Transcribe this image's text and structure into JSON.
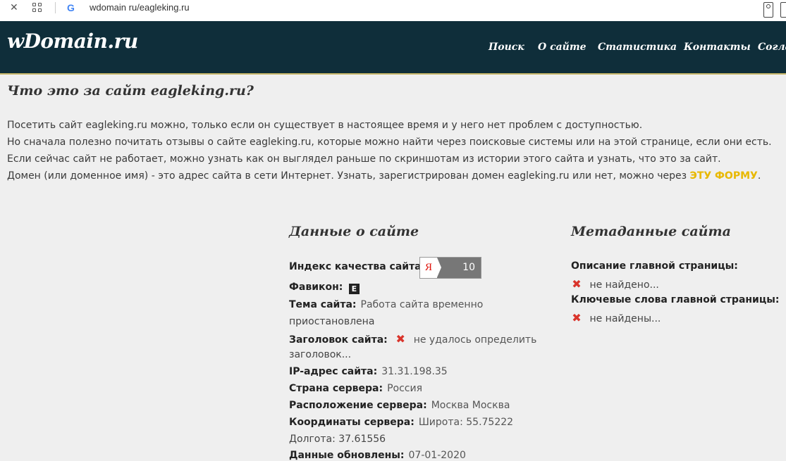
{
  "browser": {
    "close_glyph": "✕",
    "google_glyph": "G",
    "url": "wdomain ru/eagleking.ru"
  },
  "header": {
    "logo": "wDomain.ru",
    "nav": [
      "Поиск",
      "О сайте",
      "Статистика",
      "Контакты",
      "Согла"
    ]
  },
  "page": {
    "title": "Что это за сайт eagleking.ru?",
    "intro": [
      "Посетить сайт eagleking.ru можно, только если он существует в настоящее время и у него нет проблем с доступностью.",
      "Но сначала полезно почитать отзывы о сайте eagleking.ru, которые можно найти через поисковые системы или на этой странице, если они есть.",
      "Если сейчас сайт не работает, можно узнать как он выглядел раньше по скриншотам из истории этого сайта и узнать, что это за сайт.",
      "Домен (или доменное имя) - это адрес сайта в сети Интернет. Узнать, зарегистрирован домен eagleking.ru или нет, можно через "
    ],
    "form_link": "ЭТУ ФОРМУ",
    "intro_end": "."
  },
  "site_data": {
    "title": "Данные о сайте",
    "quality_label": "Индекс качества сайта:",
    "quality_logo": "Я",
    "quality_value": "10",
    "favicon_label": "Фавикон:",
    "favicon_glyph": "E",
    "theme_label": "Тема сайта:",
    "theme_value_1": "Работа сайта временно",
    "theme_value_2": "приостановлена",
    "heading_label": "Заголовок сайта:",
    "heading_value_1": "не удалось определить",
    "heading_value_2": "заголовок...",
    "ip_label": "IP-адрес сайта:",
    "ip_value": "31.31.198.35",
    "country_label": "Страна сервера:",
    "country_value": "Россия",
    "location_label": "Расположение сервера:",
    "location_value": "Москва Москва",
    "coords_label": "Координаты сервера:",
    "coords_lat": "Широта: 55.75222",
    "coords_lon": "Долгота: 37.61556",
    "updated_label": "Данные обновлены:",
    "updated_value": "07-01-2020"
  },
  "meta": {
    "title": "Метаданные сайта",
    "desc_label": "Описание главной страницы:",
    "desc_value": "не найдено...",
    "keywords_label": "Ключевые слова главной страницы:",
    "keywords_value": "не найдены..."
  },
  "icons": {
    "error": "✖"
  },
  "colors": {
    "header_bg": "#0f2e3a",
    "link_accent": "#e8b800",
    "error_red": "#d9342b"
  }
}
